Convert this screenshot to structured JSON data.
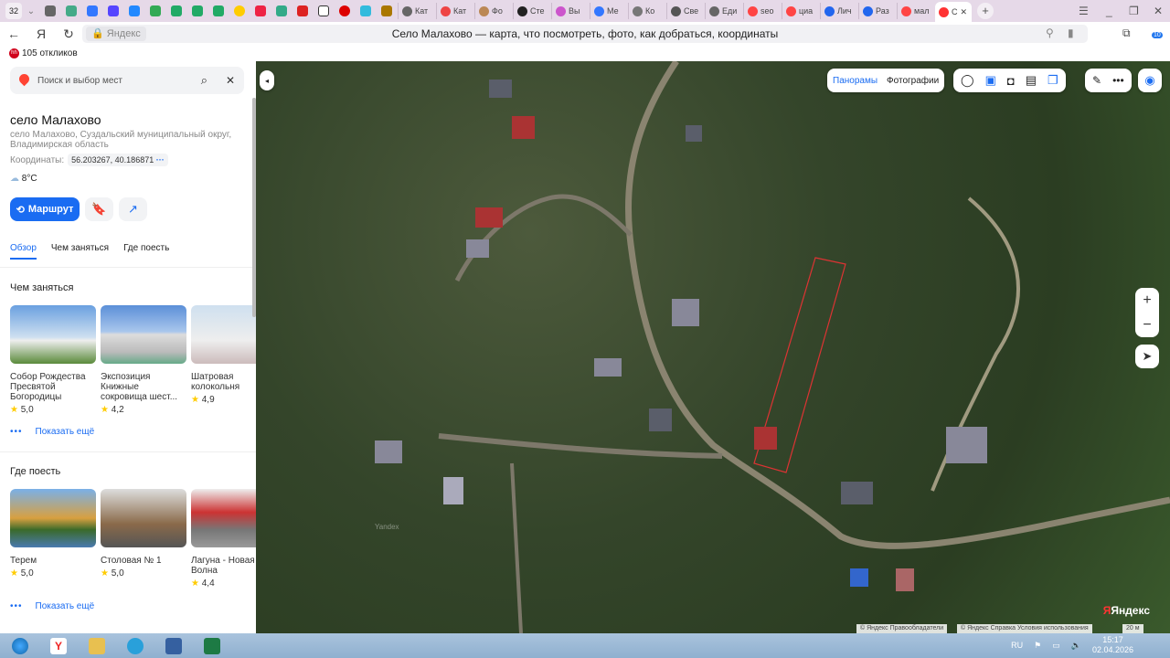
{
  "browser": {
    "tab_count": "32",
    "tabs": [
      "Кат",
      "Кат",
      "Фо",
      "Сте",
      "Вы",
      "Ме",
      "Ко",
      "Све",
      "Еди",
      "seo",
      "циа",
      "Лич",
      "Раз",
      "мал",
      "С"
    ],
    "site_chip": "Яндекс",
    "page_title": "Село Малахово — карта, что посмотреть, фото, как добраться, координаты",
    "download_badge": "10",
    "bookmark": "105 откликов"
  },
  "sidebar": {
    "search_placeholder": "Поиск и выбор мест",
    "title": "село Малахово",
    "address": "село Малахово, Суздальский муниципальный округ, Владимирская область",
    "coords_label": "Координаты:",
    "coords": "56.203267, 40.186871",
    "weather": "8°C",
    "route_label": "Маршрут",
    "tabs": [
      "Обзор",
      "Чем заняться",
      "Где поесть"
    ],
    "todo_title": "Чем заняться",
    "todo": [
      {
        "name": "Собор Рождества Пресвятой Богородицы",
        "rating": "5,0"
      },
      {
        "name": "Экспозиция Книжные сокровища шест...",
        "rating": "4,2"
      },
      {
        "name": "Шатровая колокольня",
        "rating": "4,9"
      }
    ],
    "eat_title": "Где поесть",
    "eat": [
      {
        "name": "Терем",
        "rating": "5,0"
      },
      {
        "name": "Столовая № 1",
        "rating": "5,0"
      },
      {
        "name": "Лагуна - Новая Волна",
        "rating": "4,4"
      }
    ],
    "show_more": "Показать ещё"
  },
  "map": {
    "panoramas": "Панорамы",
    "photos": "Фотографии",
    "copyright1": "© Яндекс  Правообладатели",
    "copyright2": "© Яндекс  Справка  Условия использования",
    "scale": "20 м",
    "logo": "Яндекс",
    "watermark": "Yandex"
  },
  "taskbar": {
    "lang": "RU",
    "time": "15:17",
    "date": "02.04.2026"
  }
}
